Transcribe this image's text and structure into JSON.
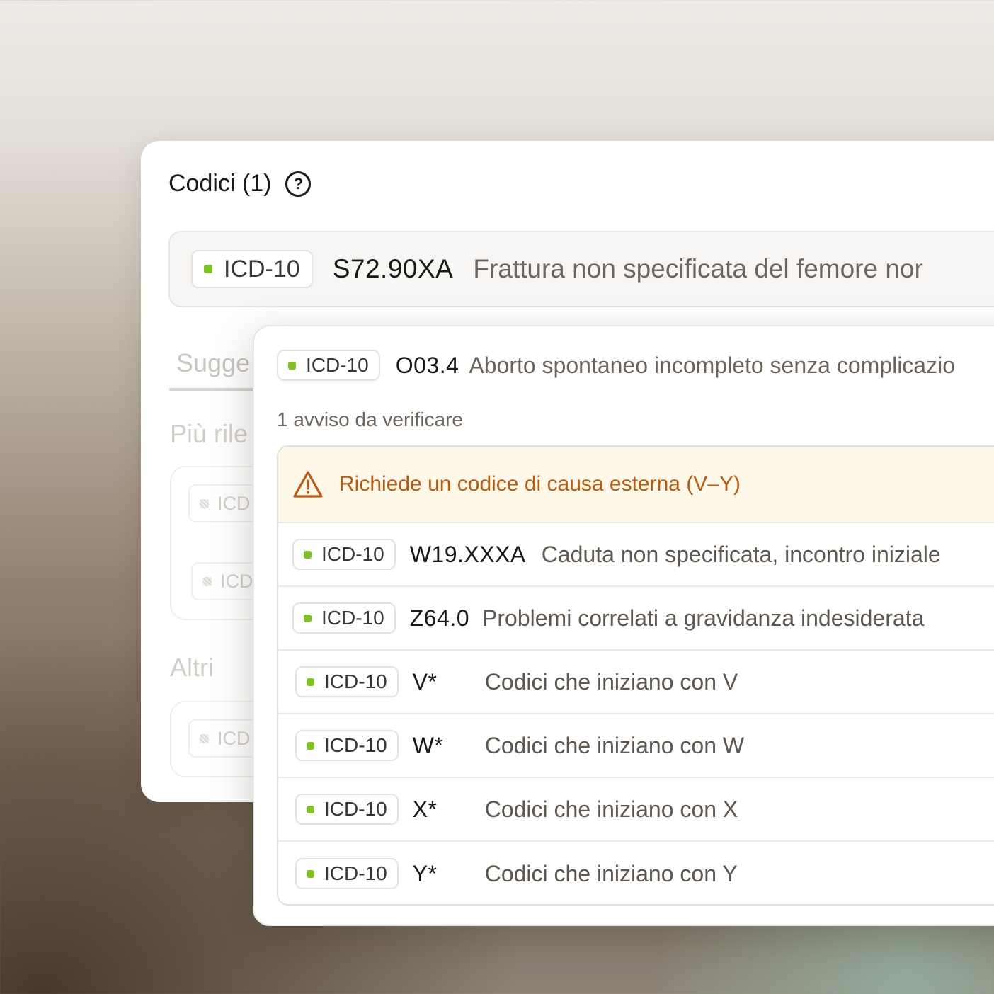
{
  "panel": {
    "title": "Codici (1)",
    "selected": {
      "system": "ICD-10",
      "code": "S72.90XA",
      "description": "Frattura non specificata del femore no",
      "cutoff_tail": "r"
    },
    "tab_partial": "Sugge",
    "section_top_partial": "Più rile",
    "section_other": "Altri",
    "ghost_badge_partial": "ICD"
  },
  "popover": {
    "top_item": {
      "system": "ICD-10",
      "code": "O03.4",
      "description": "Aborto spontaneo incompleto senza complicazio"
    },
    "warning_count": "1 avviso da verificare",
    "warning": {
      "text": "Richiede un codice di causa esterna (V–Y)",
      "icon": "warning-triangle-icon",
      "color": "#b95a13"
    },
    "rows": [
      {
        "system": "ICD-10",
        "code": "W19.XXXA",
        "description": "Caduta non specificata, incontro iniziale"
      },
      {
        "system": "ICD-10",
        "code": "Z64.0",
        "description": "Problemi correlati a gravidanza indesiderata"
      },
      {
        "system": "ICD-10",
        "code": "V*",
        "description": "Codici che iniziano con V"
      },
      {
        "system": "ICD-10",
        "code": "W*",
        "description": "Codici che iniziano con W"
      },
      {
        "system": "ICD-10",
        "code": "X*",
        "description": "Codici che iniziano con X"
      },
      {
        "system": "ICD-10",
        "code": "Y*",
        "description": "Codici che iniziano con Y"
      }
    ]
  },
  "colors": {
    "status_dot": "#7ec224",
    "warning_bg": "#fdf8e8"
  }
}
